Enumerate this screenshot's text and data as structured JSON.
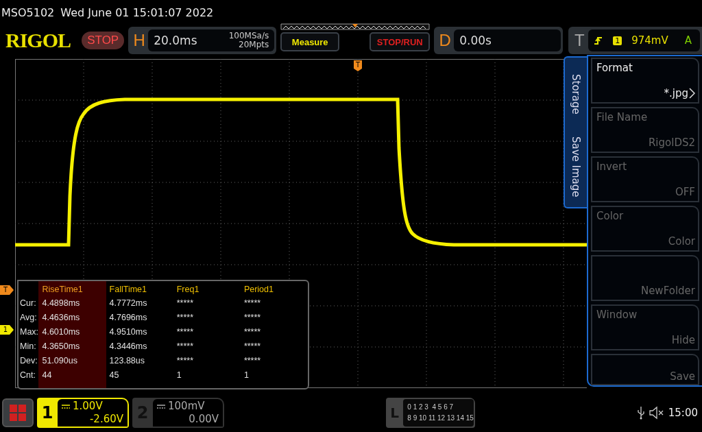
{
  "header": {
    "model": "MSO5102",
    "datetime": "Wed June 01 15:01:07 2022"
  },
  "logo": "RIGOL",
  "run_state": {
    "label": "STOP"
  },
  "horizontal": {
    "key": "H",
    "timebase": "20.0ms",
    "sample_rate": "100MSa/s",
    "memory_depth": "20Mpts"
  },
  "buttons": [
    {
      "label": "Measure",
      "kind": "measure"
    },
    {
      "label": "STOP/RUN",
      "kind": "run"
    }
  ],
  "delay": {
    "key": "D",
    "value": "0.00s"
  },
  "trigger": {
    "key": "T",
    "source": "1",
    "threshold": "974mV",
    "mode": "A"
  },
  "trigger_position": {
    "label": "T"
  },
  "markers": [
    {
      "label": "T",
      "kind": "trigger"
    },
    {
      "label": "1",
      "kind": "channel"
    }
  ],
  "measurements": {
    "row_labels": [
      "Cur:",
      "Avg:",
      "Max:",
      "Min:",
      "Dev:",
      "Cnt:"
    ],
    "columns": [
      {
        "header": "RiseTime1",
        "selected": true,
        "values": [
          "4.4898ms",
          "4.4636ms",
          "4.6010ms",
          "4.3650ms",
          "51.090us",
          "44"
        ]
      },
      {
        "header": "FallTime1",
        "selected": false,
        "values": [
          "4.7772ms",
          "4.7696ms",
          "4.9510ms",
          "4.3446ms",
          "123.88us",
          "45"
        ]
      },
      {
        "header": "Freq1",
        "selected": false,
        "values": [
          "*****",
          "*****",
          "*****",
          "*****",
          "*****",
          "1"
        ]
      },
      {
        "header": "Period1",
        "selected": false,
        "values": [
          "*****",
          "*****",
          "*****",
          "*****",
          "*****",
          "1"
        ]
      }
    ]
  },
  "side_menu": {
    "tabs": [
      "Storage",
      "Save Image"
    ],
    "softkeys": [
      {
        "label": "Format",
        "value": "*.jpg",
        "disabled": false,
        "submenu": true
      },
      {
        "label": "File Name",
        "value": "RigolDS2",
        "disabled": true,
        "submenu": false
      },
      {
        "label": "Invert",
        "value": "OFF",
        "disabled": true,
        "submenu": false
      },
      {
        "label": "Color",
        "value": "Color",
        "disabled": true,
        "submenu": false
      },
      {
        "value": "NewFolder",
        "disabled": true,
        "submenu": false
      },
      {
        "label": "Window",
        "value": "Hide",
        "disabled": true,
        "submenu": false
      },
      {
        "value": "Save",
        "disabled": true,
        "submenu": false
      }
    ]
  },
  "channels": [
    {
      "number": "1",
      "scale": "1.00V",
      "offset": "-2.60V",
      "on": true
    },
    {
      "number": "2",
      "scale": "100mV",
      "offset": "0.00V",
      "on": false
    }
  ],
  "logic": {
    "key": "L",
    "rows": [
      "0 1 2 3  4 5 6 7",
      "8 9 10 11 12 13 14 15"
    ]
  },
  "status": {
    "time": "15:00"
  }
}
